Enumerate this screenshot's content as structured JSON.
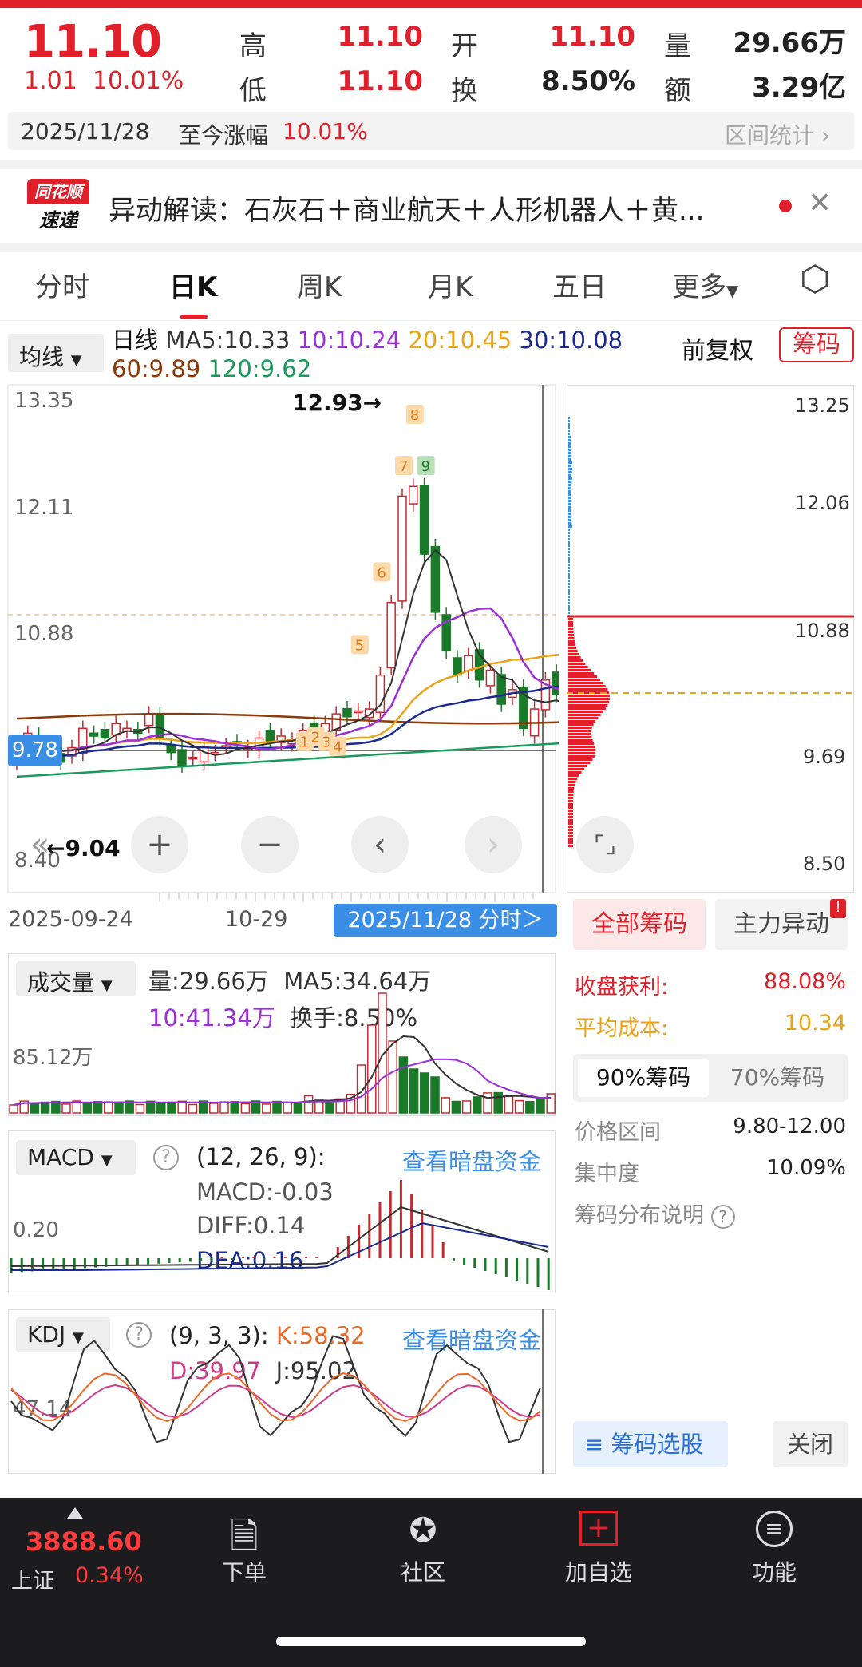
{
  "quote": {
    "price": "11.10",
    "change": "1.01",
    "change_pct": "10.01%",
    "high_label": "高",
    "high": "11.10",
    "open_label": "开",
    "open": "11.10",
    "volume_label": "量",
    "volume": "29.66万",
    "low_label": "低",
    "low": "11.10",
    "turnover_label": "换",
    "turnover": "8.50%",
    "amount_label": "额",
    "amount": "3.29亿"
  },
  "dateline": {
    "date": "2025/11/28",
    "since_label": "至今涨幅",
    "since_value": "10.01%",
    "range_stats": "区间统计"
  },
  "banner": {
    "logo_top": "同花顺",
    "logo_bottom": "速递",
    "text": "异动解读：石灰石＋商业航天＋人形机器人＋黄..."
  },
  "tabs": [
    "分时",
    "日K",
    "周K",
    "月K",
    "五日",
    "更多",
    "⬡"
  ],
  "ma_bar": {
    "selector": "均线",
    "daily": "日线",
    "ma5": "MA5:10.33",
    "ma10": "10:10.24",
    "ma20": "20:10.45",
    "ma30": "30:10.08",
    "ma60": "60:9.89",
    "ma120": "120:9.62",
    "adjust": "前复权",
    "chips_btn": "筹码"
  },
  "kchart": {
    "ymax": "13.35",
    "y2": "12.11",
    "y3": "10.88",
    "current": "9.78",
    "ymin": "8.40",
    "peak": "12.93→",
    "low_mark": "←9.04",
    "date_start": "2025-09-24",
    "date_mid": "10-29",
    "date_sel": "2025/11/28 分时＞",
    "seq_labels": [
      "1",
      "2",
      "3",
      "4",
      "5",
      "6",
      "7",
      "8",
      "9"
    ]
  },
  "volume": {
    "selector": "成交量",
    "vol": "量:29.66万",
    "ma5": "MA5:34.64万",
    "ma10": "10:41.34万",
    "turnover": "换手:8.50%",
    "ytick": "85.12万"
  },
  "macd": {
    "selector": "MACD",
    "params": "(12, 26, 9):",
    "macd": "MACD:-0.03",
    "diff": "DIFF:0.14",
    "dea": "DEA:0.16",
    "ytick": "0.20",
    "link": "查看暗盘资金"
  },
  "kdj": {
    "selector": "KDJ",
    "params": "(9, 3, 3):",
    "k": "K:58.32",
    "d": "D:39.97",
    "j": "J:95.02",
    "ytick": "47.14",
    "link": "查看暗盘资金"
  },
  "chips": {
    "p1": "13.25",
    "p2": "12.06",
    "p3": "10.88",
    "p4": "9.69",
    "p5": "8.50",
    "tab_all": "全部筹码",
    "tab_main": "主力异动",
    "profit_label": "收盘获利:",
    "profit": "88.08%",
    "cost_label": "平均成本:",
    "cost": "10.34",
    "pct90": "90%筹码",
    "pct70": "70%筹码",
    "range_label": "价格区间",
    "range": "9.80-12.00",
    "conc_label": "集中度",
    "conc": "10.09%",
    "explain": "筹码分布说明",
    "select": "筹码选股",
    "close": "关闭"
  },
  "bottom": {
    "index_value": "3888.60",
    "index_name": "上证",
    "index_pct": "0.34%",
    "order": "下单",
    "community": "社区",
    "add": "加自选",
    "func": "功能"
  },
  "colors": {
    "red": "#e0212b",
    "green": "#1a9a3a",
    "ma5": "#333333",
    "ma10": "#9b30d9",
    "ma20": "#e8a317",
    "ma30": "#1b2a8f",
    "ma60": "#8b3a0a",
    "ma120": "#1a9a5a"
  }
}
